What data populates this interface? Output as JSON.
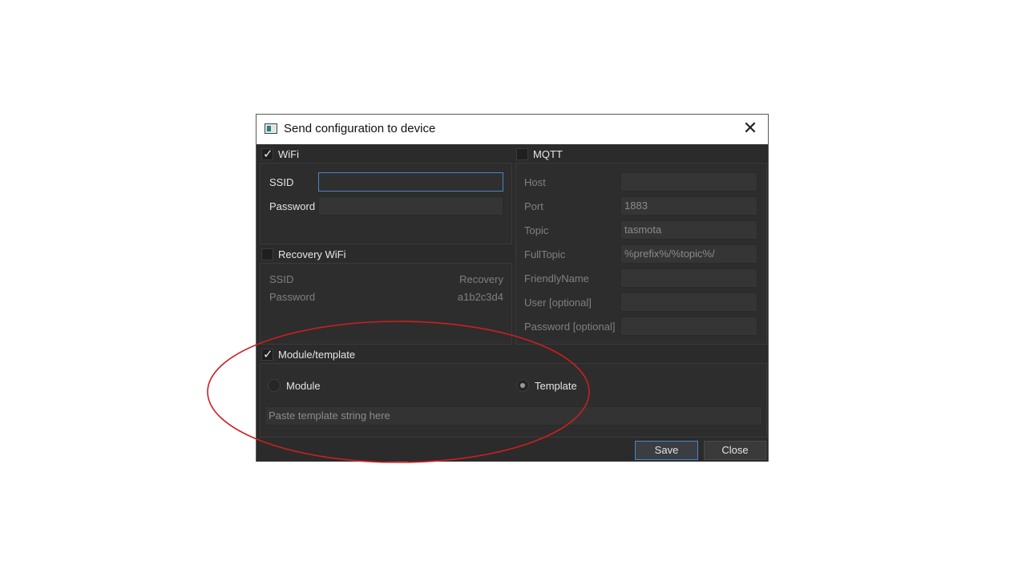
{
  "window": {
    "title": "Send configuration to device",
    "close_glyph": "✕"
  },
  "wifi": {
    "label": "WiFi",
    "checked": true,
    "ssid_label": "SSID",
    "ssid_value": "",
    "password_label": "Password",
    "password_value": ""
  },
  "recovery_wifi": {
    "label": "Recovery WiFi",
    "checked": false,
    "ssid_label": "SSID",
    "ssid_value": "Recovery",
    "password_label": "Password",
    "password_value": "a1b2c3d4"
  },
  "mqtt": {
    "label": "MQTT",
    "checked": false,
    "fields": [
      {
        "label": "Host",
        "value": ""
      },
      {
        "label": "Port",
        "value": "1883"
      },
      {
        "label": "Topic",
        "value": "tasmota"
      },
      {
        "label": "FullTopic",
        "value": "%prefix%/%topic%/"
      },
      {
        "label": "FriendlyName",
        "value": ""
      },
      {
        "label": "User [optional]",
        "value": ""
      },
      {
        "label": "Password [optional]",
        "value": ""
      }
    ]
  },
  "module_template": {
    "label": "Module/template",
    "checked": true,
    "module_label": "Module",
    "template_label": "Template",
    "selected": "Template",
    "template_placeholder": "Paste template string here"
  },
  "buttons": {
    "save": "Save",
    "close": "Close"
  },
  "colors": {
    "accent": "#4a86c9",
    "annotation": "#cc1f1f",
    "background": "#2b2b2b"
  }
}
